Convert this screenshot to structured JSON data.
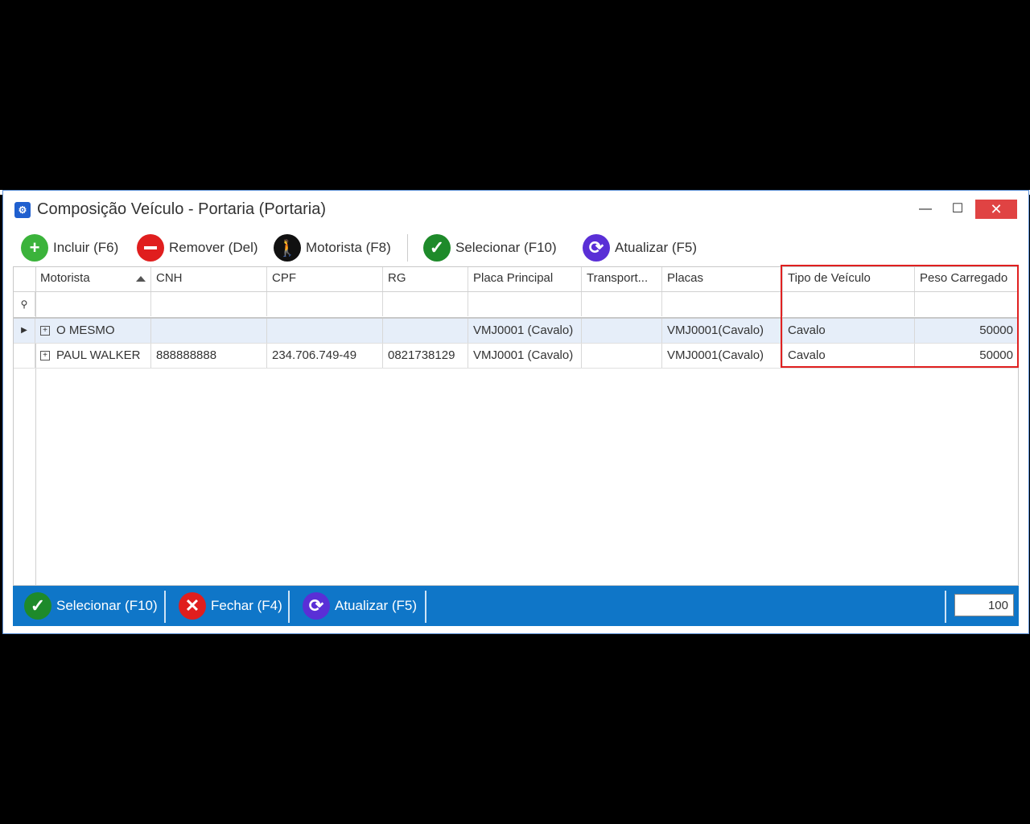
{
  "window": {
    "title": "Composição Veículo - Portaria (Portaria)"
  },
  "toolbar": {
    "incluir": "Incluir (F6)",
    "remover": "Remover (Del)",
    "motorista": "Motorista (F8)",
    "selecionar": "Selecionar (F10)",
    "atualizar": "Atualizar (F5)"
  },
  "grid": {
    "columns": [
      "Motorista",
      "CNH",
      "CPF",
      "RG",
      "Placa Principal",
      "Transport...",
      "Placas",
      "Tipo de Veículo",
      "Peso Carregado"
    ],
    "rows": [
      {
        "motorista": "O MESMO",
        "cnh": "",
        "cpf": "",
        "rg": "",
        "placa_principal": "VMJ0001 (Cavalo)",
        "transport": "",
        "placas": "VMJ0001(Cavalo)",
        "tipo": "Cavalo",
        "peso": "50000"
      },
      {
        "motorista": "PAUL WALKER",
        "cnh": "888888888",
        "cpf": "234.706.749-49",
        "rg": "0821738129",
        "placa_principal": "VMJ0001 (Cavalo)",
        "transport": "",
        "placas": "VMJ0001(Cavalo)",
        "tipo": "Cavalo",
        "peso": "50000"
      }
    ]
  },
  "footer": {
    "selecionar": "Selecionar (F10)",
    "fechar": "Fechar (F4)",
    "atualizar": "Atualizar (F5)",
    "page_size": "100"
  },
  "colors": {
    "accent": "#0f76c8",
    "highlight": "#e02020"
  }
}
